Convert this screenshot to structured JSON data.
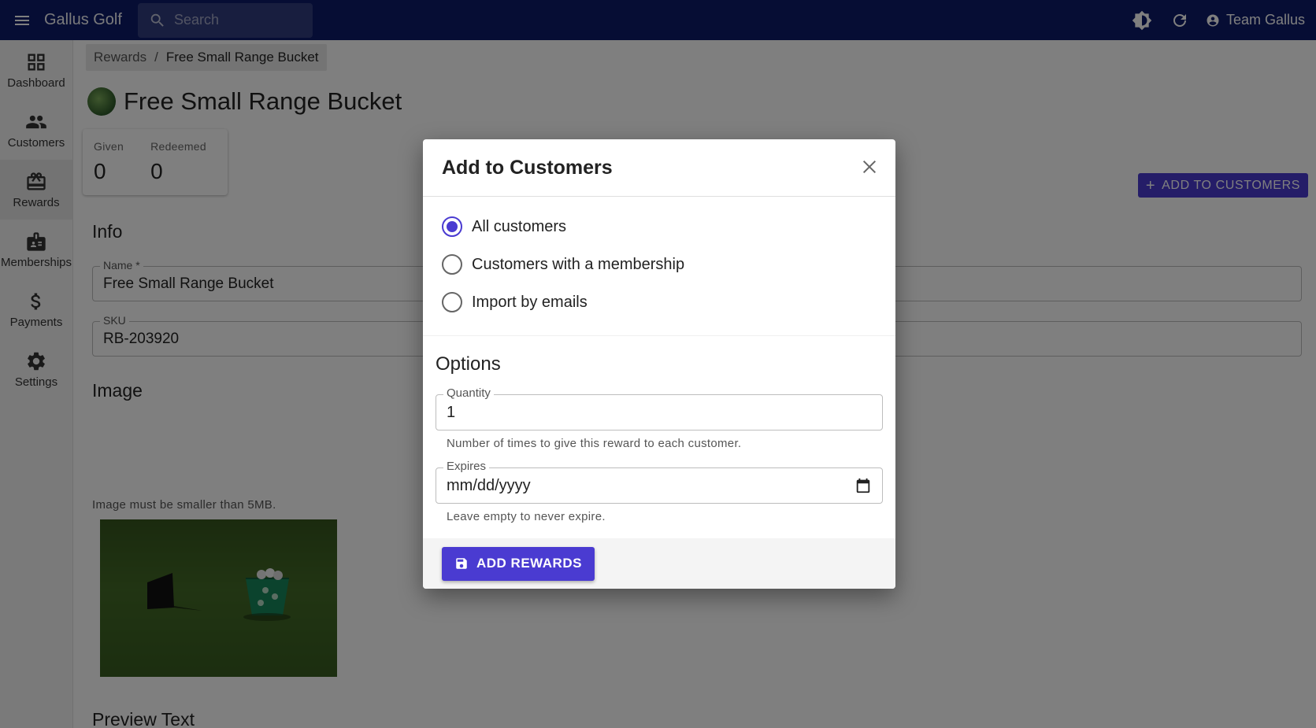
{
  "appbar": {
    "brand": "Gallus Golf",
    "search_placeholder": "Search",
    "user_name": "Team Gallus",
    "icons": [
      "menu-icon",
      "search-icon",
      "brightness-icon",
      "refresh-icon",
      "account-circle-icon"
    ]
  },
  "sidebar": {
    "items": [
      {
        "label": "Dashboard",
        "icon": "dashboard-icon"
      },
      {
        "label": "Customers",
        "icon": "people-icon"
      },
      {
        "label": "Rewards",
        "icon": "redeem-icon",
        "active": true
      },
      {
        "label": "Memberships",
        "icon": "badge-icon"
      },
      {
        "label": "Payments",
        "icon": "dollar-icon"
      },
      {
        "label": "Settings",
        "icon": "gear-icon"
      }
    ]
  },
  "main": {
    "breadcrumb": {
      "parent": "Rewards",
      "separator": "/",
      "current": "Free Small Range Bucket"
    },
    "title": "Free Small Range Bucket",
    "stats": [
      {
        "label": "Given",
        "value": "0"
      },
      {
        "label": "Redeemed",
        "value": "0"
      }
    ],
    "add_to_customers_label": "ADD TO CUSTOMERS",
    "info_heading": "Info",
    "name_label": "Name *",
    "name_value": "Free Small Range Bucket",
    "sku_label": "SKU",
    "sku_value": "RB-203920",
    "image_heading": "Image",
    "image_hint": "Image must be smaller than 5MB.",
    "preview_heading": "Preview Text"
  },
  "dialog": {
    "title": "Add to Customers",
    "radio_options": [
      {
        "label": "All customers",
        "checked": true
      },
      {
        "label": "Customers with a membership",
        "checked": false
      },
      {
        "label": "Import by emails",
        "checked": false
      }
    ],
    "options_heading": "Options",
    "quantity_label": "Quantity",
    "quantity_value": "1",
    "quantity_helper": "Number of times to give this reward to each customer.",
    "expires_label": "Expires",
    "expires_placeholder": "mm/dd/yyyy",
    "expires_helper": "Leave empty to never expire.",
    "submit_label": "ADD REWARDS"
  },
  "colors": {
    "appbar": "#0d1b69",
    "primary": "#4a3bd1",
    "sidebar_bg": "#f4f4f4"
  }
}
